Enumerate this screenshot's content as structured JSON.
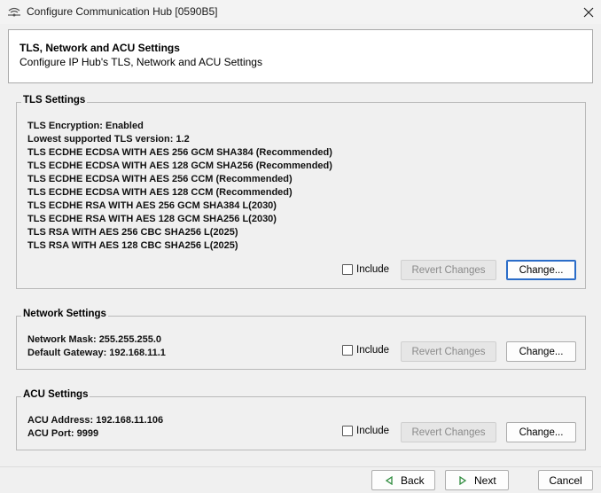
{
  "window": {
    "title": "Configure Communication Hub [0590B5]"
  },
  "header": {
    "title": "TLS, Network and ACU Settings",
    "subtitle": "Configure IP Hub's TLS, Network and ACU Settings"
  },
  "tls": {
    "group_title": "TLS Settings",
    "lines": [
      "TLS Encryption: Enabled",
      "Lowest supported TLS version: 1.2",
      "TLS ECDHE ECDSA WITH AES 256 GCM SHA384 (Recommended)",
      "TLS ECDHE ECDSA WITH AES 128 GCM SHA256 (Recommended)",
      "TLS ECDHE ECDSA WITH AES 256 CCM (Recommended)",
      "TLS ECDHE ECDSA WITH AES 128 CCM (Recommended)",
      "TLS ECDHE RSA WITH AES 256 GCM SHA384 L(2030)",
      "TLS ECDHE RSA WITH AES 128 GCM SHA256 L(2030)",
      "TLS RSA WITH AES 256 CBC SHA256 L(2025)",
      "TLS RSA WITH AES 128 CBC SHA256 L(2025)"
    ],
    "include_label": "Include",
    "revert_label": "Revert Changes",
    "change_label": "Change..."
  },
  "network": {
    "group_title": "Network Settings",
    "lines": [
      "Network Mask: 255.255.255.0",
      "Default Gateway: 192.168.11.1"
    ],
    "include_label": "Include",
    "revert_label": "Revert Changes",
    "change_label": "Change..."
  },
  "acu": {
    "group_title": "ACU Settings",
    "lines": [
      "ACU Address: 192.168.11.106",
      "ACU Port: 9999"
    ],
    "include_label": "Include",
    "revert_label": "Revert Changes",
    "change_label": "Change..."
  },
  "footer": {
    "back_label": "Back",
    "next_label": "Next",
    "cancel_label": "Cancel"
  },
  "colors": {
    "nav_arrow": "#2e8b3d",
    "focus_border": "#2a6cc8"
  }
}
